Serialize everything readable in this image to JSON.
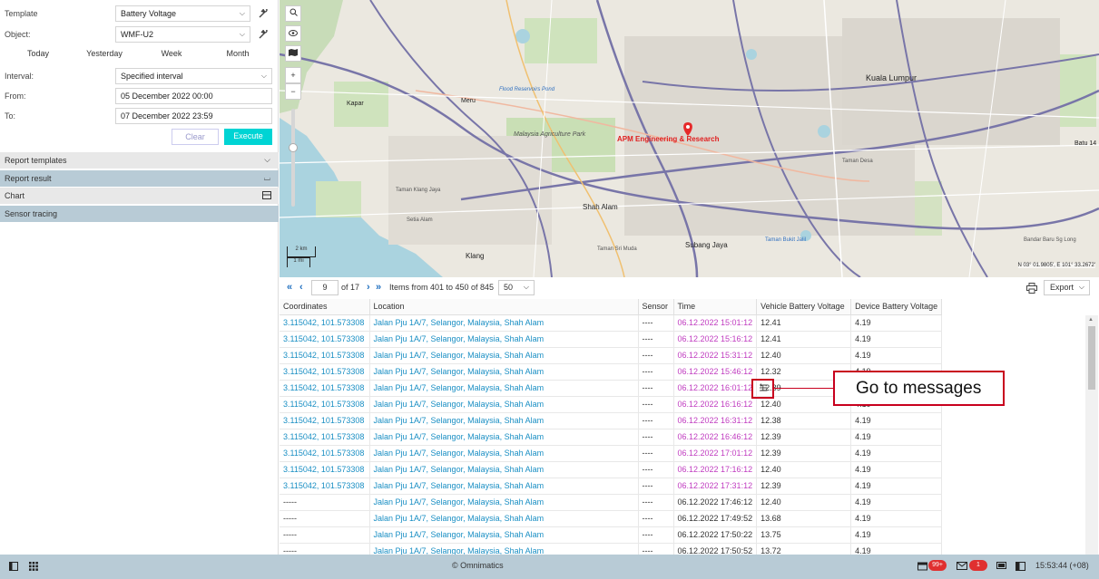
{
  "form": {
    "template_label": "Template",
    "template_value": "Battery Voltage",
    "object_label": "Object:",
    "object_value": "WMF-U2",
    "interval_label": "Interval:",
    "interval_value": "Specified interval",
    "from_label": "From:",
    "from_value": "05 December 2022 00:00",
    "to_label": "To:",
    "to_value": "07 December 2022 23:59",
    "tabs": [
      "Today",
      "Yesterday",
      "Week",
      "Month"
    ],
    "clear_label": "Clear",
    "execute_label": "Execute"
  },
  "sections": {
    "report_templates": "Report templates",
    "report_result": "Report result",
    "chart": "Chart",
    "sensor_tracing": "Sensor tracing"
  },
  "map": {
    "labels": [
      "Kuala Lumpur",
      "Shah Alam",
      "Subang Jaya",
      "Klang",
      "Kapar",
      "Meru",
      "Taman Klang Jaya",
      "Batu 14",
      "Malaysia Agriculture Park",
      "Flood Reservoirs Pond",
      "Taman Sri Muda",
      "Taman Bukit Jalil",
      "Setia Alam",
      "Taman Desa",
      "Bandar Baru Sg Long"
    ],
    "marker_label": "APM Engineering & Research",
    "scale_km": "2 km",
    "scale_mi": "1 mi",
    "coords": "N 03° 01.9805', E 101° 33.2672'"
  },
  "pager": {
    "page": "9",
    "of_pages": "of 17",
    "items_text": "Items from 401 to 450 of 845",
    "per_page": "50",
    "export_label": "Export"
  },
  "table": {
    "columns": [
      "Coordinates",
      "Location",
      "Sensor",
      "Time",
      "Vehicle Battery Voltage",
      "Device Battery Voltage"
    ],
    "rows": [
      [
        "3.115042, 101.573308",
        "Jalan Pju 1A/7, Selangor, Malaysia, Shah Alam",
        "----",
        "06.12.2022 15:01:12",
        "12.41",
        "4.19"
      ],
      [
        "3.115042, 101.573308",
        "Jalan Pju 1A/7, Selangor, Malaysia, Shah Alam",
        "----",
        "06.12.2022 15:16:12",
        "12.41",
        "4.19"
      ],
      [
        "3.115042, 101.573308",
        "Jalan Pju 1A/7, Selangor, Malaysia, Shah Alam",
        "----",
        "06.12.2022 15:31:12",
        "12.40",
        "4.19"
      ],
      [
        "3.115042, 101.573308",
        "Jalan Pju 1A/7, Selangor, Malaysia, Shah Alam",
        "----",
        "06.12.2022 15:46:12",
        "12.32",
        "4.19"
      ],
      [
        "3.115042, 101.573308",
        "Jalan Pju 1A/7, Selangor, Malaysia, Shah Alam",
        "----",
        "06.12.2022 16:01:12",
        "12.39",
        "4.19"
      ],
      [
        "3.115042, 101.573308",
        "Jalan Pju 1A/7, Selangor, Malaysia, Shah Alam",
        "----",
        "06.12.2022 16:16:12",
        "12.40",
        "4.19"
      ],
      [
        "3.115042, 101.573308",
        "Jalan Pju 1A/7, Selangor, Malaysia, Shah Alam",
        "----",
        "06.12.2022 16:31:12",
        "12.38",
        "4.19"
      ],
      [
        "3.115042, 101.573308",
        "Jalan Pju 1A/7, Selangor, Malaysia, Shah Alam",
        "----",
        "06.12.2022 16:46:12",
        "12.39",
        "4.19"
      ],
      [
        "3.115042, 101.573308",
        "Jalan Pju 1A/7, Selangor, Malaysia, Shah Alam",
        "----",
        "06.12.2022 17:01:12",
        "12.39",
        "4.19"
      ],
      [
        "3.115042, 101.573308",
        "Jalan Pju 1A/7, Selangor, Malaysia, Shah Alam",
        "----",
        "06.12.2022 17:16:12",
        "12.40",
        "4.19"
      ],
      [
        "3.115042, 101.573308",
        "Jalan Pju 1A/7, Selangor, Malaysia, Shah Alam",
        "----",
        "06.12.2022 17:31:12",
        "12.39",
        "4.19"
      ],
      [
        "-----",
        "Jalan Pju 1A/7, Selangor, Malaysia, Shah Alam",
        "----",
        "06.12.2022 17:46:12",
        "12.40",
        "4.19"
      ],
      [
        "-----",
        "Jalan Pju 1A/7, Selangor, Malaysia, Shah Alam",
        "----",
        "06.12.2022 17:49:52",
        "13.68",
        "4.19"
      ],
      [
        "-----",
        "Jalan Pju 1A/7, Selangor, Malaysia, Shah Alam",
        "----",
        "06.12.2022 17:50:22",
        "13.75",
        "4.19"
      ],
      [
        "-----",
        "Jalan Pju 1A/7, Selangor, Malaysia, Shah Alam",
        "----",
        "06.12.2022 17:50:52",
        "13.72",
        "4.19"
      ]
    ]
  },
  "annotation": {
    "text": "Go to messages"
  },
  "status": {
    "copyright": "© Omnimatics",
    "notif_count": "99+",
    "mail_count": "1",
    "clock": "15:53:44 (+08)"
  },
  "colors": {
    "accent": "#00d4d4",
    "link": "#1a8fc4",
    "time": "#c03cc0",
    "annotation": "#c8001e"
  }
}
